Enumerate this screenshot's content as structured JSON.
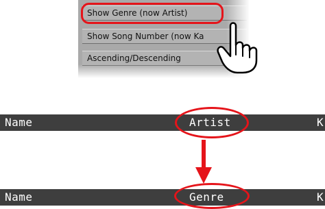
{
  "menu": {
    "items": [
      {
        "label": "Show Genre (now Artist)"
      },
      {
        "label": "Show Song Number (now Ka"
      },
      {
        "label": "Ascending/Descending"
      }
    ]
  },
  "header_before": {
    "col_name": "Name",
    "col_mid": "Artist",
    "col_right": "K"
  },
  "header_after": {
    "col_name": "Name",
    "col_mid": "Genre",
    "col_right": "K"
  },
  "colors": {
    "highlight": "#e5141a",
    "header_bg": "#3e3e3e",
    "menu_bg": "#b3b3b3"
  },
  "icons": {
    "pointer": "pointing-hand-icon",
    "arrow": "arrow-down-icon"
  }
}
